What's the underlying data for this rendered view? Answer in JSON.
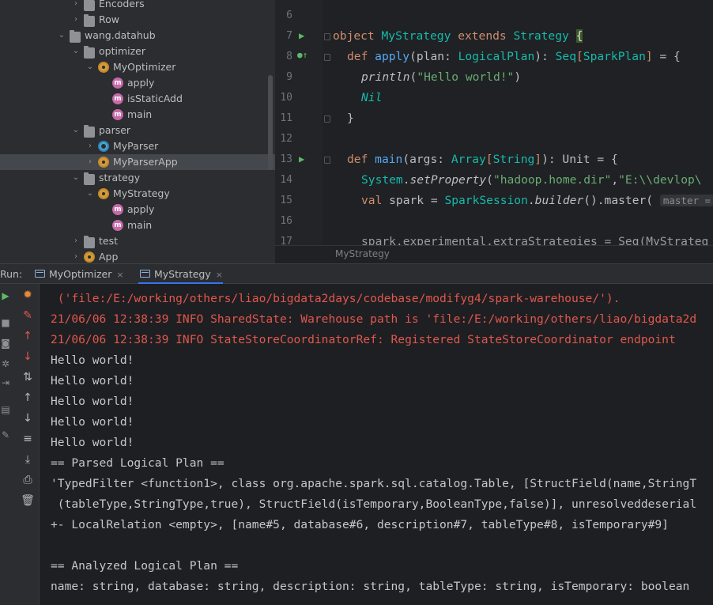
{
  "tree": {
    "items": [
      {
        "label": "Encoders",
        "kind": "folder",
        "arrow": "›",
        "indent": 0
      },
      {
        "label": "Row",
        "kind": "folder",
        "arrow": "›",
        "indent": 0
      },
      {
        "label": "wang.datahub",
        "kind": "package",
        "arrow": "⌄",
        "indent": 0
      },
      {
        "label": "optimizer",
        "kind": "folder",
        "arrow": "⌄",
        "indent": 1
      },
      {
        "label": "MyOptimizer",
        "kind": "object",
        "arrow": "⌄",
        "indent": 2
      },
      {
        "label": "apply",
        "kind": "method",
        "arrow": "",
        "indent": 3
      },
      {
        "label": "isStaticAdd",
        "kind": "method",
        "arrow": "",
        "indent": 3
      },
      {
        "label": "main",
        "kind": "method",
        "arrow": "",
        "indent": 3
      },
      {
        "label": "parser",
        "kind": "folder",
        "arrow": "⌄",
        "indent": 1
      },
      {
        "label": "MyParser",
        "kind": "class",
        "arrow": "›",
        "indent": 2
      },
      {
        "label": "MyParserApp",
        "kind": "object",
        "arrow": "›",
        "indent": 2
      },
      {
        "label": "strategy",
        "kind": "folder",
        "arrow": "⌄",
        "indent": 1
      },
      {
        "label": "MyStrategy",
        "kind": "object",
        "arrow": "⌄",
        "indent": 2
      },
      {
        "label": "apply",
        "kind": "method",
        "arrow": "",
        "indent": 3
      },
      {
        "label": "main",
        "kind": "method",
        "arrow": "",
        "indent": 3
      },
      {
        "label": "test",
        "kind": "folder",
        "arrow": "›",
        "indent": 1
      },
      {
        "label": "App",
        "kind": "object",
        "arrow": "›",
        "indent": 1
      }
    ],
    "method_letter": "m"
  },
  "editor": {
    "line_numbers": [
      "6",
      "7",
      "8",
      "9",
      "10",
      "11",
      "12",
      "13",
      "14",
      "15",
      "16",
      "17"
    ],
    "l7": {
      "kw1": "object",
      "name": "MyStrategy",
      "kw2": "extends",
      "parent": "Strategy",
      "brace": "{"
    },
    "l8": {
      "kw": "def",
      "fn": "apply",
      "open": "(plan: ",
      "t1": "LogicalPlan",
      "mid": "): ",
      "t2": "Seq",
      "b1": "[",
      "t3": "SparkPlan",
      "b2": "]",
      "end": " = {"
    },
    "l9": {
      "fn": "println",
      "open": "(",
      "str": "\"Hello world!\"",
      "close": ")"
    },
    "l10": {
      "text": "Nil"
    },
    "l11": {
      "text": "}"
    },
    "l13": {
      "kw": "def",
      "fn": "main",
      "open": "(args: ",
      "t1": "Array",
      "b1": "[",
      "t2": "String",
      "b2": "]",
      "mid": "): Unit = {"
    },
    "l14": {
      "obj": "System",
      "dot": ".",
      "fn": "setProperty",
      "open": "(",
      "s1": "\"hadoop.home.dir\"",
      "comma": ",",
      "s2": "\"E:\\\\devlop\\"
    },
    "l15": {
      "kw": "val",
      "var": " spark = ",
      "obj": "SparkSession",
      "dot1": ".",
      "fn1": "builder",
      "mid": "().",
      "fn2": "master",
      "open": "(",
      "hint": "master ="
    },
    "l17": {
      "text": "spark.experimental.extraStrategies = Seq(MyStrateg"
    },
    "breadcrumb": "MyStrategy"
  },
  "run": {
    "label": "Run:",
    "tabs": [
      {
        "label": "MyOptimizer",
        "close": "×"
      },
      {
        "label": "MyStrategy",
        "close": "×"
      }
    ]
  },
  "console": {
    "lines": [
      {
        "text": " ('file:/E:/working/others/liao/bigdata2days/codebase/modifyg4/spark-warehouse/').",
        "err": true
      },
      {
        "text": "21/06/06 12:38:39 INFO SharedState: Warehouse path is 'file:/E:/working/others/liao/bigdata2d",
        "err": true
      },
      {
        "text": "21/06/06 12:38:39 INFO StateStoreCoordinatorRef: Registered StateStoreCoordinator endpoint",
        "err": true
      },
      {
        "text": "Hello world!",
        "err": false
      },
      {
        "text": "Hello world!",
        "err": false
      },
      {
        "text": "Hello world!",
        "err": false
      },
      {
        "text": "Hello world!",
        "err": false
      },
      {
        "text": "Hello world!",
        "err": false
      },
      {
        "text": "== Parsed Logical Plan ==",
        "err": false
      },
      {
        "text": "'TypedFilter <function1>, class org.apache.spark.sql.catalog.Table, [StructField(name,StringT",
        "err": false
      },
      {
        "text": " (tableType,StringType,true), StructField(isTemporary,BooleanType,false)], unresolveddeserial",
        "err": false
      },
      {
        "text": "+- LocalRelation <empty>, [name#5, database#6, description#7, tableType#8, isTemporary#9]",
        "err": false
      },
      {
        "text": "",
        "err": false
      },
      {
        "text": "== Analyzed Logical Plan ==",
        "err": false
      },
      {
        "text": "name: string, database: string, description: string, tableType: string, isTemporary: boolean",
        "err": false
      }
    ]
  },
  "colors": {
    "accent": "#3574f0",
    "error_text": "#e0574d",
    "run_green": "#5fb865"
  }
}
